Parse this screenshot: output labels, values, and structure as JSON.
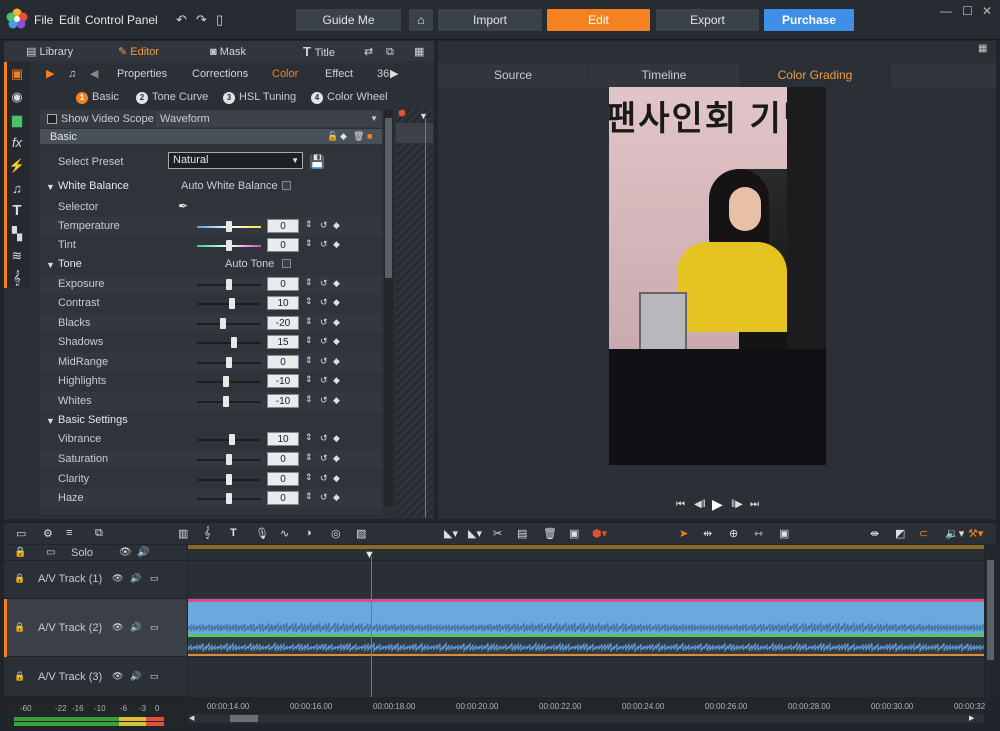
{
  "menu": {
    "file": "File",
    "edit": "Edit",
    "control_panel": "Control Panel"
  },
  "nav": {
    "guide": "Guide Me",
    "import": "Import",
    "edit": "Edit",
    "export": "Export",
    "purchase": "Purchase"
  },
  "subtabs": {
    "library": "Library",
    "editor": "Editor",
    "mask": "Mask",
    "title": "Title"
  },
  "panel_tabs": [
    "Properties",
    "Corrections",
    "Color",
    "Effect",
    "36"
  ],
  "steps": [
    {
      "num": "1",
      "label": "Basic"
    },
    {
      "num": "2",
      "label": "Tone Curve"
    },
    {
      "num": "3",
      "label": "HSL Tuning"
    },
    {
      "num": "4",
      "label": "Color Wheel"
    }
  ],
  "scope": {
    "label": "Show Video Scope",
    "value": "Waveform"
  },
  "section_header": "Basic",
  "preset": {
    "label": "Select Preset",
    "value": "Natural"
  },
  "white_balance": {
    "title": "White Balance",
    "auto": "Auto White Balance",
    "selector": "Selector"
  },
  "tone": {
    "title": "Tone",
    "auto": "Auto Tone"
  },
  "basic_settings": {
    "title": "Basic Settings"
  },
  "sliders": [
    {
      "label": "Temperature",
      "value": "0",
      "pos": 0.5,
      "style": "grad1"
    },
    {
      "label": "Tint",
      "value": "0",
      "pos": 0.5,
      "style": "grad2"
    },
    {
      "label": "Exposure",
      "value": "0",
      "pos": 0.5,
      "style": ""
    },
    {
      "label": "Contrast",
      "value": "10",
      "pos": 0.55,
      "style": ""
    },
    {
      "label": "Blacks",
      "value": "-20",
      "pos": 0.4,
      "style": ""
    },
    {
      "label": "Shadows",
      "value": "15",
      "pos": 0.575,
      "style": ""
    },
    {
      "label": "MidRange",
      "value": "0",
      "pos": 0.5,
      "style": ""
    },
    {
      "label": "Highlights",
      "value": "-10",
      "pos": 0.45,
      "style": ""
    },
    {
      "label": "Whites",
      "value": "-10",
      "pos": 0.45,
      "style": ""
    },
    {
      "label": "Vibrance",
      "value": "10",
      "pos": 0.55,
      "style": ""
    },
    {
      "label": "Saturation",
      "value": "0",
      "pos": 0.5,
      "style": ""
    },
    {
      "label": "Clarity",
      "value": "0",
      "pos": 0.5,
      "style": ""
    },
    {
      "label": "Haze",
      "value": "0",
      "pos": 0.5,
      "style": ""
    }
  ],
  "view_tabs": [
    "Source",
    "Timeline",
    "Color Grading"
  ],
  "preview_sign": "팬사인회 기념",
  "timeline": {
    "solo": "Solo",
    "tracks": [
      "A/V Track (1)",
      "A/V Track (2)",
      "A/V Track (3)"
    ],
    "ruler": [
      "00:00:14.00",
      "00:00:16.00",
      "00:00:18.00",
      "00:00:20.00",
      "00:00:22.00",
      "00:00:24.00",
      "00:00:26.00",
      "00:00:28.00",
      "00:00:30.00",
      "00:00:32"
    ],
    "meter": [
      "-60",
      "-22",
      "-16",
      "-10",
      "-6",
      "-3",
      "0"
    ]
  },
  "colors": {
    "accent": "#f58220",
    "purchase": "#3f8ee8",
    "clip": "#6aa8de"
  }
}
